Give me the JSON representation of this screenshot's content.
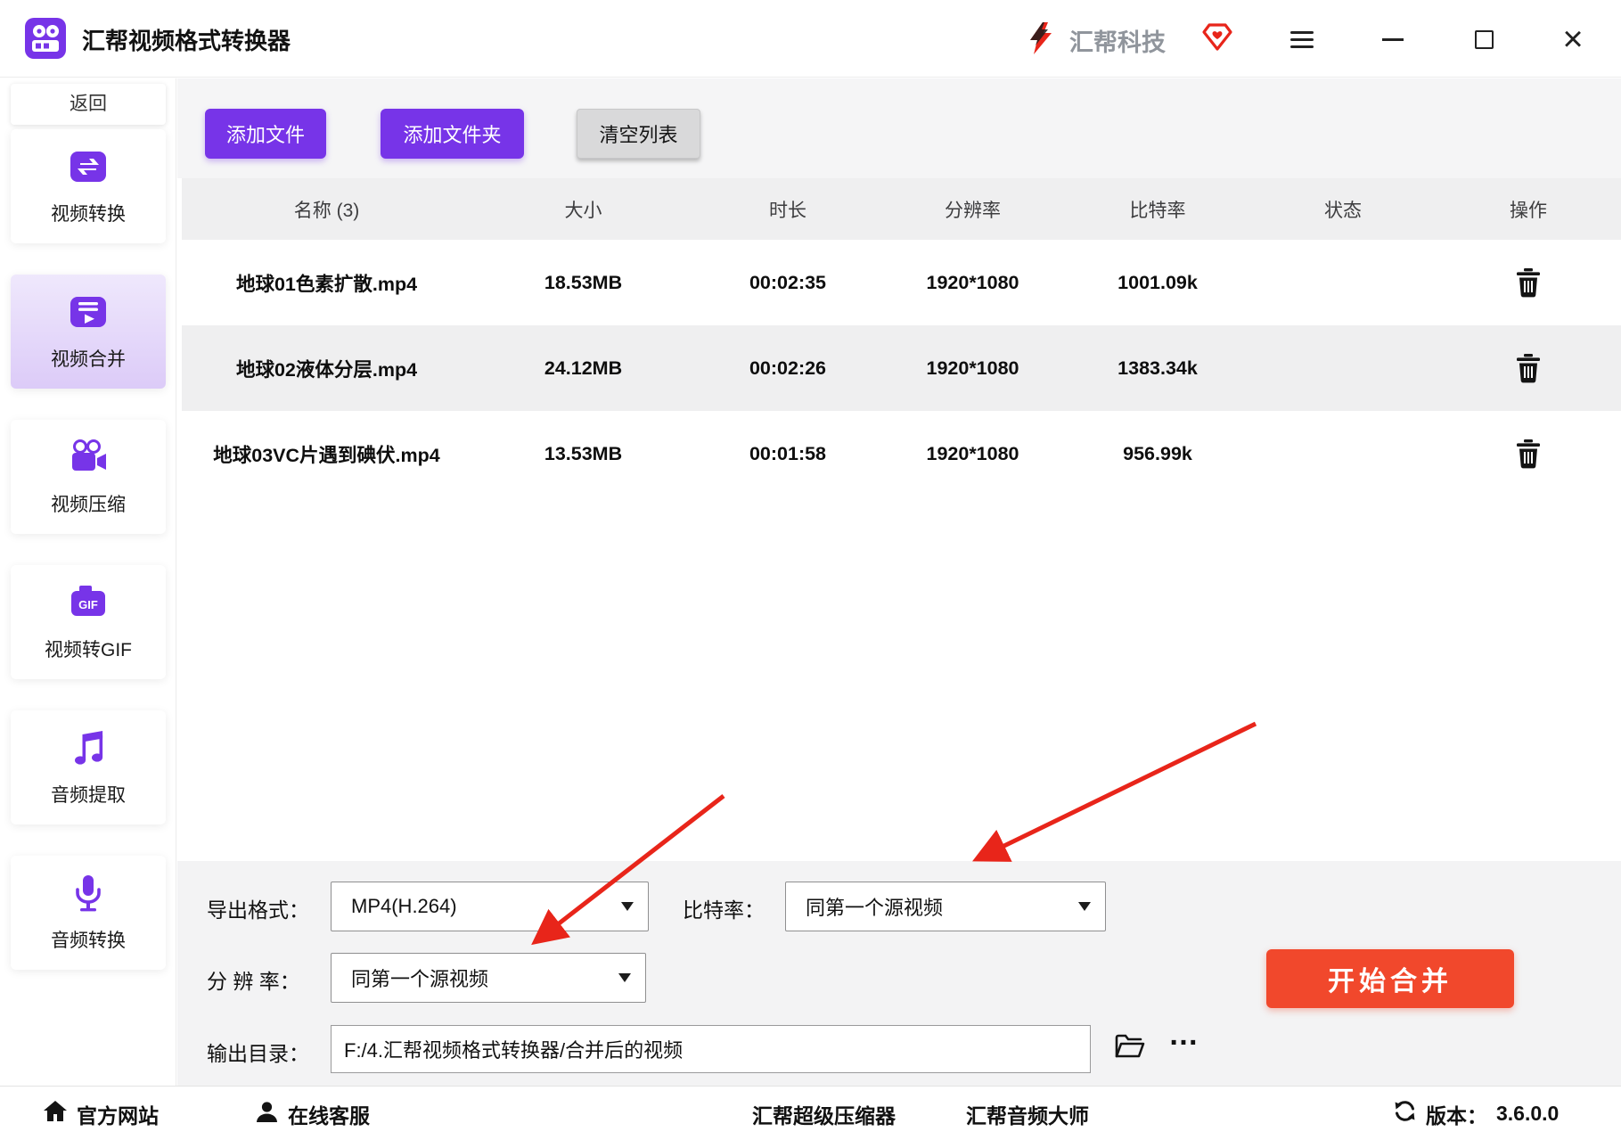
{
  "colors": {
    "accent_purple": "#7734e8",
    "start_button_red": "#f1482c",
    "progress_pink": "#eba7bf",
    "annotation_red": "#e8251a",
    "brand_gray": "#90959c"
  },
  "icons": {
    "app": "film-camera-icon",
    "brand_logo": "red-lightning-icon",
    "brand_diamond": "red-diamond-icon",
    "menu": "hamburger-icon",
    "minimize": "line-icon",
    "maximize": "square-icon",
    "close": "×",
    "video_convert": "sync-arrows-icon",
    "video_merge": "playlist-play-icon",
    "video_compress": "movie-camera-icon",
    "video_to_gif": "gif-badge-icon",
    "audio_extract": "music-note-icon",
    "audio_convert": "microphone-icon",
    "delete": "trash-icon",
    "browse": "open-folder-icon",
    "more": "…",
    "official_site": "house-icon",
    "online_service": "person-icon",
    "version": "refresh-icon"
  },
  "titlebar": {
    "app_title": "汇帮视频格式转换器",
    "brand_text": "汇帮科技",
    "close_glyph": "×"
  },
  "sidebar": {
    "back_label": "返回",
    "items": [
      {
        "label": "视频转换",
        "active": false
      },
      {
        "label": "视频合并",
        "active": true
      },
      {
        "label": "视频压缩",
        "active": false
      },
      {
        "label": "视频转GIF",
        "active": false
      },
      {
        "label": "音频提取",
        "active": false
      },
      {
        "label": "音频转换",
        "active": false
      }
    ]
  },
  "toolbar": {
    "add_file_label": "添加文件",
    "add_folder_label": "添加文件夹",
    "clear_list_label": "清空列表"
  },
  "table": {
    "headers": [
      "名称 (3)",
      "大小",
      "时长",
      "分辨率",
      "比特率",
      "状态",
      "操作"
    ],
    "rows": [
      {
        "name": "地球01色素扩散.mp4",
        "size": "18.53MB",
        "duration": "00:02:35",
        "resolution": "1920*1080",
        "bitrate": "1001.09k"
      },
      {
        "name": "地球02液体分层.mp4",
        "size": "24.12MB",
        "duration": "00:02:26",
        "resolution": "1920*1080",
        "bitrate": "1383.34k"
      },
      {
        "name": "地球03VC片遇到碘伏.mp4",
        "size": "13.53MB",
        "duration": "00:01:58",
        "resolution": "1920*1080",
        "bitrate": "956.99k"
      }
    ]
  },
  "settings": {
    "export_format_label": "导出格式：",
    "export_format_value": "MP4(H.264)",
    "bitrate_label": "比特率：",
    "bitrate_value": "同第一个源视频",
    "resolution_label": "分 辨 率：",
    "resolution_value": "同第一个源视频",
    "output_dir_label": "输出目录：",
    "output_dir_value": "F:/4.汇帮视频格式转换器/合并后的视频",
    "more_label": "…",
    "start_label": "开始合并"
  },
  "statusbar": {
    "official_site": "官方网站",
    "online_service": "在线客服",
    "super_compressor": "汇帮超级压缩器",
    "audio_master": "汇帮音频大师",
    "version_label": "版本：",
    "version_value": "3.6.0.0"
  }
}
